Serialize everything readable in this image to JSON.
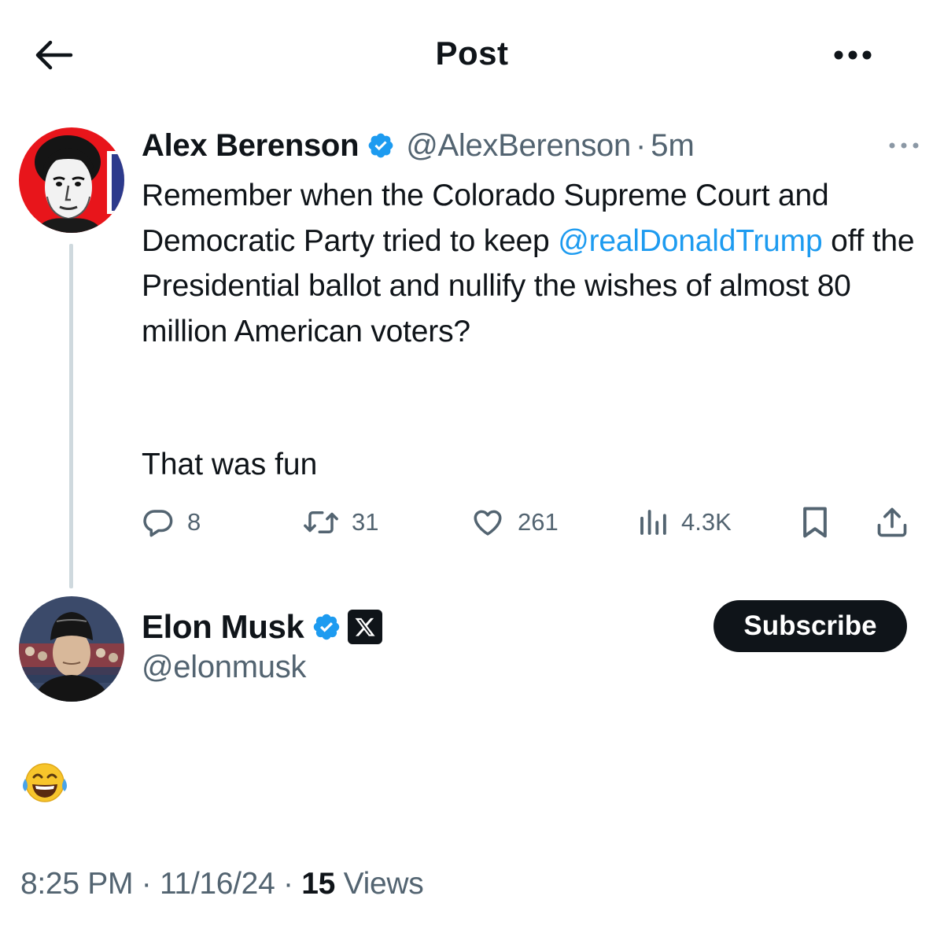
{
  "header": {
    "title": "Post",
    "back_icon": "arrow-left-icon",
    "more_icon": "more-horizontal-icon"
  },
  "parent_tweet": {
    "author_name": "Alex Berenson",
    "handle": "@AlexBerenson",
    "separator": "·",
    "time": "5m",
    "text_before_mention": "Remember when the Colorado Supreme Court and Democratic Party tried to keep ",
    "mention": "@realDonaldTrump",
    "text_after_mention": " off the Presidential ballot and nullify the wishes of almost 80 million American voters?",
    "text_second_paragraph": "That was fun",
    "actions": {
      "replies": "8",
      "reposts": "31",
      "likes": "261",
      "views": "4.3K"
    }
  },
  "reply": {
    "author_name": "Elon Musk",
    "handle": "@elonmusk",
    "subscribe_label": "Subscribe",
    "emoji_name": "face-with-tears-of-joy"
  },
  "meta": {
    "time": "8:25 PM",
    "date": "11/16/24",
    "separator": "·",
    "views_count": "15",
    "views_label": "Views"
  },
  "colors": {
    "accent": "#1d9bf0",
    "text_primary": "#0f1419",
    "text_secondary": "#536471",
    "thread_line": "#cfd9de",
    "button_bg": "#0f1419"
  }
}
